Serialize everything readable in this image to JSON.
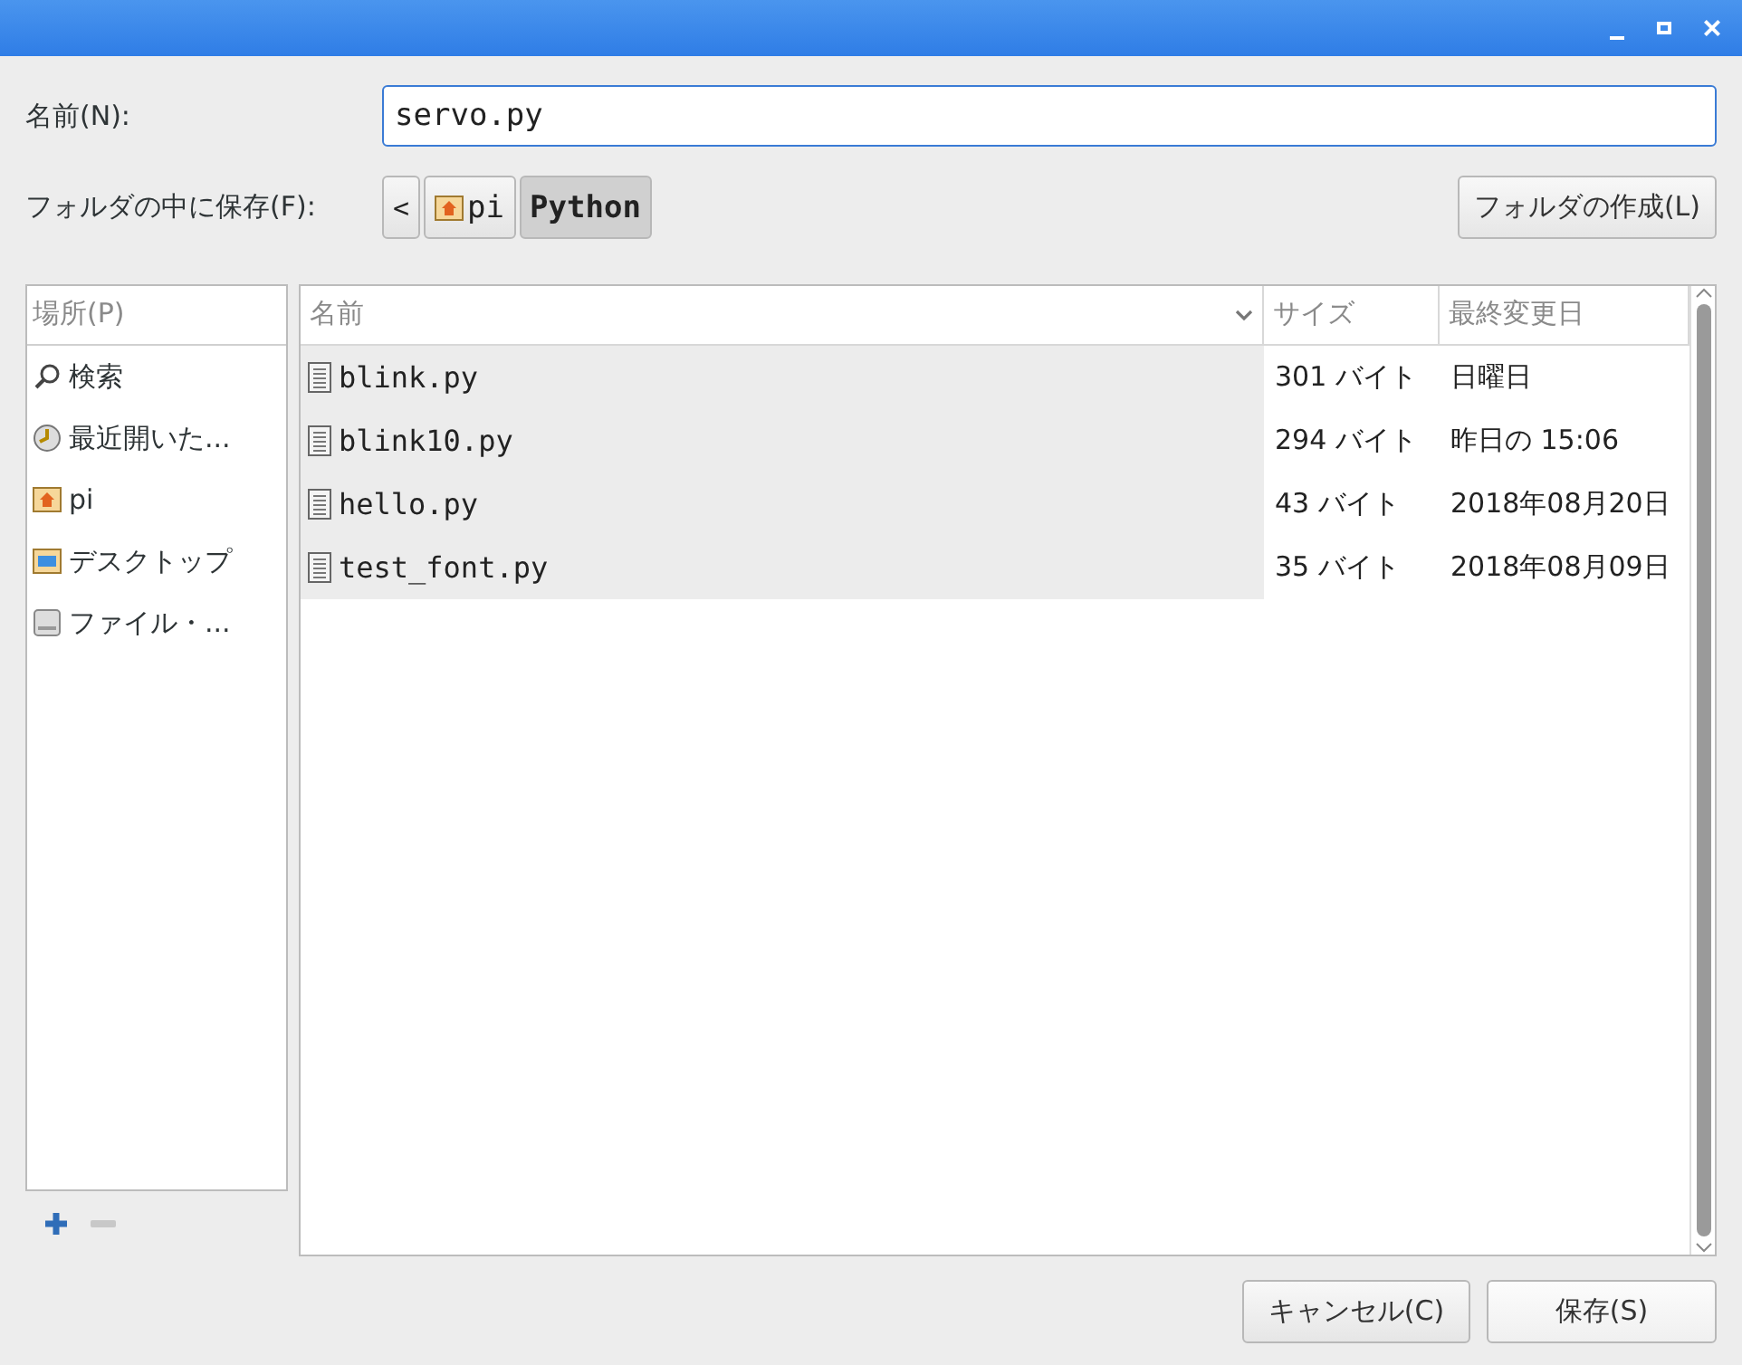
{
  "window": {
    "controls": [
      {
        "kind": "minimize"
      },
      {
        "kind": "maximize"
      },
      {
        "kind": "close"
      }
    ]
  },
  "name_field": {
    "label": "名前(N):",
    "value": "servo.py"
  },
  "folder_row": {
    "label": "フォルダの中に保存(F):",
    "back": "<",
    "path": [
      {
        "label": "pi",
        "kind": "home",
        "selected": false
      },
      {
        "label": "Python",
        "kind": "plain",
        "selected": true
      }
    ],
    "create_button": "フォルダの作成(L)"
  },
  "sidebar": {
    "header": "場所(P)",
    "items": [
      {
        "label": "検索",
        "kind": "search"
      },
      {
        "label": "最近開いた...",
        "kind": "recent"
      },
      {
        "label": "pi",
        "kind": "home"
      },
      {
        "label": "デスクトップ",
        "kind": "desktop"
      },
      {
        "label": "ファイル・...",
        "kind": "drive"
      }
    ]
  },
  "table": {
    "columns": [
      "名前",
      "サイズ",
      "最終変更日"
    ],
    "rows": [
      {
        "name": "blink.py",
        "size": "301 バイト",
        "modified": "日曜日"
      },
      {
        "name": "blink10.py",
        "size": "294 バイト",
        "modified": "昨日の 15:06"
      },
      {
        "name": "hello.py",
        "size": "43 バイト",
        "modified": "2018年08月20日"
      },
      {
        "name": "test_font.py",
        "size": "35 バイト",
        "modified": "2018年08月09日"
      }
    ]
  },
  "buttons": [
    {
      "label": "キャンセル(C)",
      "kind": "cancel"
    },
    {
      "label": "保存(S)",
      "kind": "save"
    }
  ]
}
